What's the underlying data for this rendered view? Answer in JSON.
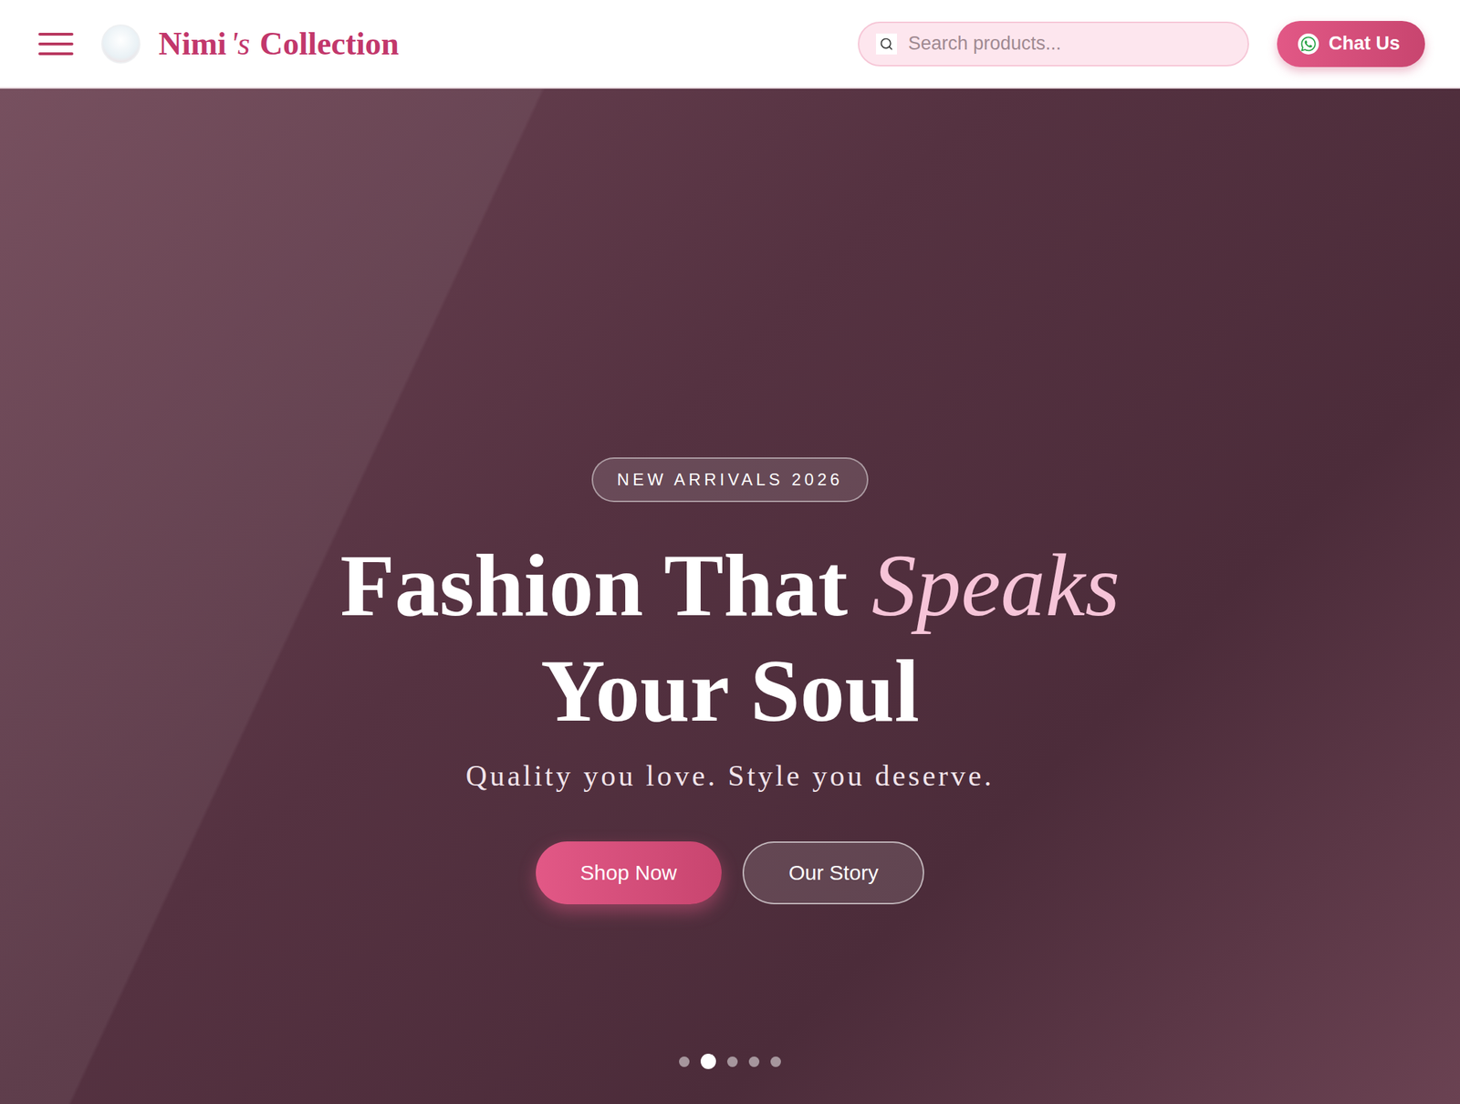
{
  "header": {
    "brand": {
      "name": "Nimi",
      "possessive": "'s",
      "suffix": "Collection"
    },
    "search": {
      "placeholder": "Search products..."
    },
    "chat_button": "Chat Us"
  },
  "hero": {
    "badge": "NEW ARRIVALS 2026",
    "headline": [
      [
        {
          "text": "Fashion That",
          "accent": false
        },
        {
          "text": "Speaks",
          "accent": true
        }
      ],
      [
        {
          "text": "Your Soul",
          "accent": false
        }
      ]
    ],
    "subtitle": "Quality you love. Style you deserve.",
    "buttons": [
      {
        "label": "Shop Now",
        "kind": "primary"
      },
      {
        "label": "Our Story",
        "kind": "outline"
      }
    ],
    "slides": [
      {
        "selected": false
      },
      {
        "selected": true
      },
      {
        "selected": false
      },
      {
        "selected": false
      },
      {
        "selected": false
      }
    ]
  }
}
